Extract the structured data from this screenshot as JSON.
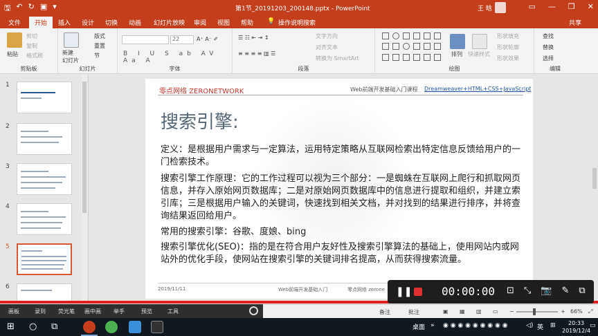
{
  "window": {
    "title": "第1节_20191203_200148.pptx - PowerPoint",
    "user": "王 晗",
    "controls": [
      "▭",
      "—",
      "❐",
      "✕"
    ]
  },
  "tabs": [
    "文件",
    "开始",
    "插入",
    "设计",
    "切换",
    "动画",
    "幻灯片放映",
    "审阅",
    "视图",
    "帮助",
    "操作说明搜索",
    "共享"
  ],
  "ribbon": {
    "clipboard": {
      "paste": "粘贴",
      "cut": "剪切",
      "copy": "复制",
      "format_painter": "格式刷",
      "label": "剪贴板"
    },
    "slides": {
      "new_slide": "新建\n幻灯片",
      "layout": "版式",
      "reset": "重置",
      "section": "节",
      "label": "幻灯片"
    },
    "font": {
      "name": "",
      "size": "22",
      "label": "字体",
      "format_buttons": "B I U S ab AV Aa A"
    },
    "paragraph": {
      "text_direction": "文字方向",
      "align_text": "对齐文本",
      "smartart": "转换为 SmartArt",
      "label": "段落"
    },
    "drawing": {
      "arrange": "排列",
      "quick_styles": "快速样式",
      "shape_fill": "形状填充",
      "shape_outline": "形状轮廓",
      "shape_effects": "形状效果",
      "label": "绘图"
    },
    "editing": {
      "find": "查找",
      "replace": "替换",
      "select": "选择",
      "label": "编辑"
    }
  },
  "thumbnails": [
    {
      "num": "1",
      "selected": false
    },
    {
      "num": "2",
      "selected": false
    },
    {
      "num": "3",
      "selected": false
    },
    {
      "num": "4",
      "selected": false
    },
    {
      "num": "5",
      "selected": true
    },
    {
      "num": "6",
      "selected": false
    }
  ],
  "slide": {
    "brand": "零点网络 ZERONETWORK",
    "course": "Web前端开发基础入门课程",
    "tech": "Dreamweaver+HTML+CSS+JavaScript",
    "heading": "搜索引擎:",
    "paragraphs": [
      "定义：是根据用户需求与一定算法，运用特定策略从互联网检索出特定信息反馈给用户的一门检索技术。",
      "搜索引擎工作原理：它的工作过程可以视为三个部分：一是蜘蛛在互联网上爬行和抓取网页信息，并存入原始网页数据库；二是对原始网页数据库中的信息进行提取和组织，并建立索引库；三是根据用户输入的关键词，快速找到相关文档，并对找到的结果进行排序，并将查询结果返回给用户。",
      "常用的搜索引擎：谷歌、度娘、bing",
      "搜索引擎优化(SEO)：指的是在符合用户友好性及搜索引擎算法的基础上，使用网站内或网站外的优化手段，使网站在搜索引擎的关键词排名提高，从而获得搜索流量。"
    ],
    "footer_date": "2019/11/11",
    "footer_course": "Web前端开发基础入门",
    "footer_brand": "零点网络 zerone"
  },
  "status": {
    "notes": "备注",
    "comments": "批注",
    "zoom": "66%"
  },
  "overlay_bar": [
    "画板",
    "录到",
    "荧光笔",
    "画中画",
    "举手",
    "预览",
    "工具"
  ],
  "recorder": {
    "time": "00:00:00"
  },
  "taskbar": {
    "desktop": "桌面",
    "ime": "英",
    "time": "20:33",
    "date": "2019/12/4"
  },
  "colors": {
    "accent": "#c43e1c",
    "selected_thumb": "#d8572e",
    "record": "#e03030"
  }
}
